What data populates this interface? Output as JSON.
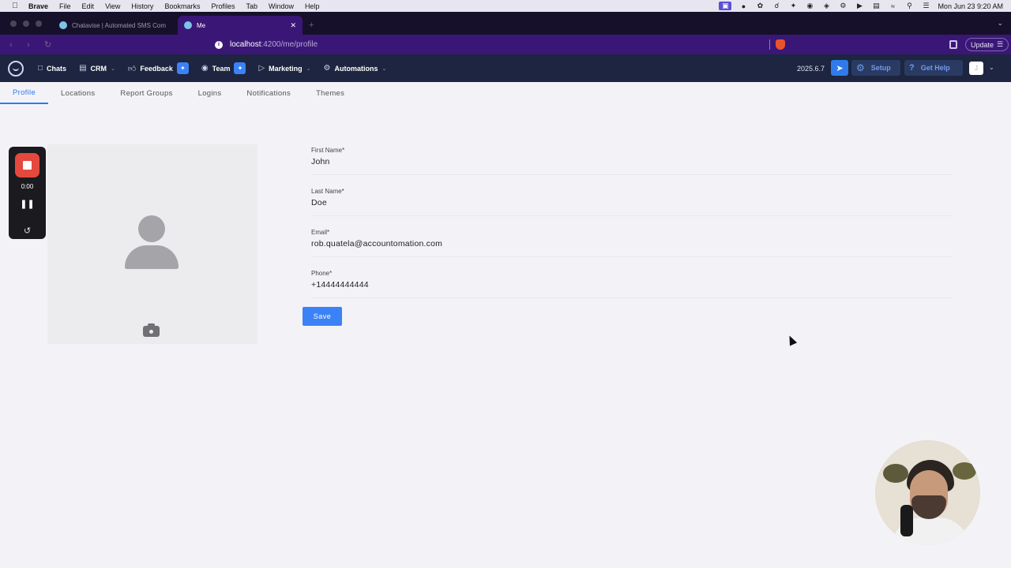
{
  "menubar": {
    "items": [
      "Brave",
      "File",
      "Edit",
      "View",
      "History",
      "Bookmarks",
      "Profiles",
      "Tab",
      "Window",
      "Help"
    ],
    "clock": "Mon Jun 23  9:20 AM"
  },
  "browser": {
    "tabs": [
      {
        "title": "Chatavise | Automated SMS Com"
      },
      {
        "title": "Me"
      }
    ],
    "url_host": "localhost",
    "url_path": ":4200/me/profile",
    "update_label": "Update"
  },
  "appnav": {
    "items": [
      {
        "label": "Chats"
      },
      {
        "label": "CRM"
      },
      {
        "label": "Feedback"
      },
      {
        "label": "Team"
      },
      {
        "label": "Marketing"
      },
      {
        "label": "Automations"
      }
    ],
    "version": "2025.6.7",
    "setup_label": "Setup",
    "help_label": "Get Help",
    "avatar_initial": "J"
  },
  "subtabs": [
    {
      "label": "Profile",
      "active": true
    },
    {
      "label": "Locations"
    },
    {
      "label": "Report Groups"
    },
    {
      "label": "Logins"
    },
    {
      "label": "Notifications"
    },
    {
      "label": "Themes"
    }
  ],
  "form": {
    "first_name": {
      "label": "First Name*",
      "value": "John"
    },
    "last_name": {
      "label": "Last Name*",
      "value": "Doe"
    },
    "email": {
      "label": "Email*",
      "value": "rob.quatela@accountomation.com"
    },
    "phone": {
      "label": "Phone*",
      "value": "+14444444444"
    },
    "save_label": "Save"
  },
  "recorder": {
    "time": "0:00"
  },
  "colors": {
    "accent": "#3b82f6",
    "app_nav_bg": "#1d2540",
    "browser_bg": "#3a1777",
    "record_red": "#e5483d"
  }
}
